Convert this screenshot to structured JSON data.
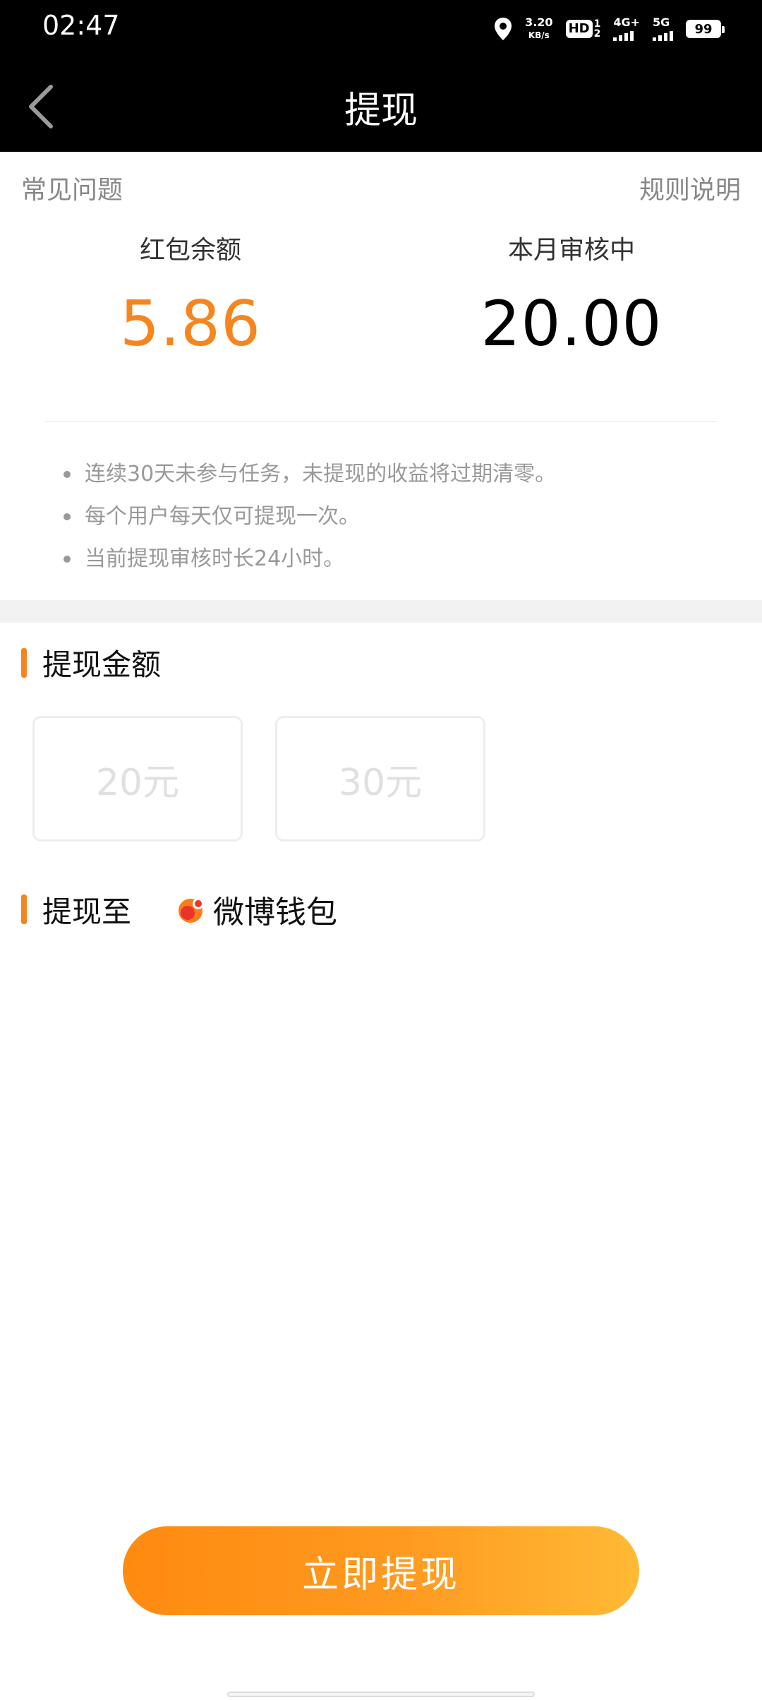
{
  "status_bar": {
    "time": "02:47",
    "net_speed_value": "3.20",
    "net_speed_unit": "KB/s",
    "hd_label": "HD",
    "hd_sub_top": "1",
    "hd_sub_bottom": "2",
    "sim1_label": "4G+",
    "sim2_label": "5G",
    "battery": "99"
  },
  "nav": {
    "title": "提现"
  },
  "links": {
    "faq": "常见问题",
    "rules": "规则说明"
  },
  "balances": {
    "red_packet_label": "红包余额",
    "red_packet_value": "5.86",
    "pending_label": "本月审核中",
    "pending_value": "20.00"
  },
  "notes": [
    "连续30天未参与任务，未提现的收益将过期清零。",
    "每个用户每天仅可提现一次。",
    "当前提现审核时长24小时。"
  ],
  "amount_section": {
    "title": "提现金额",
    "options": [
      "20元",
      "30元"
    ]
  },
  "destination_section": {
    "title": "提现至",
    "wallet_label": "微博钱包"
  },
  "withdraw_button": "立即提现",
  "colors": {
    "accent": "#f5861f",
    "nav_bg": "#000000"
  }
}
